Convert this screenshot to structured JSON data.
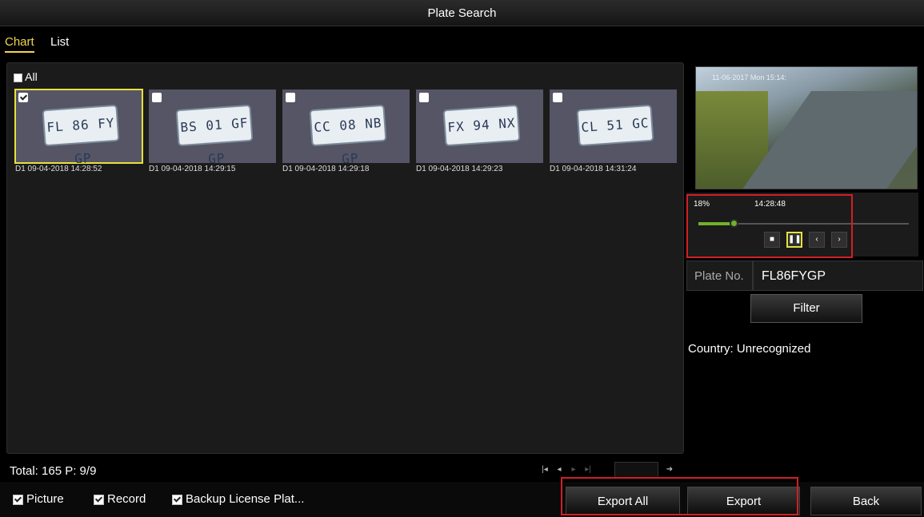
{
  "window": {
    "title": "Plate Search"
  },
  "tabs": [
    {
      "label": "Chart"
    },
    {
      "label": "List"
    }
  ],
  "select_all": {
    "label": "All",
    "checked": false
  },
  "results": [
    {
      "caption": "D1 09-04-2018 14:28:52",
      "plate_text": "FL 86 FY GP",
      "checked": true,
      "selected": true
    },
    {
      "caption": "D1 09-04-2018 14:29:15",
      "plate_text": "BS 01 GF GP",
      "checked": false,
      "selected": false
    },
    {
      "caption": "D1 09-04-2018 14:29:18",
      "plate_text": "CC 08 NB GP",
      "checked": false,
      "selected": false
    },
    {
      "caption": "D1 09-04-2018 14:29:23",
      "plate_text": "FX 94 NX",
      "checked": false,
      "selected": false
    },
    {
      "caption": "D1 09-04-2018 14:31:24",
      "plate_text": "CL 51 GC",
      "checked": false,
      "selected": false
    }
  ],
  "preview": {
    "osd_text": "11-06-2017 Mon 15:14:"
  },
  "playback": {
    "progress_label": "18%",
    "progress_fraction": 0.18,
    "time": "14:28:48",
    "buttons": [
      {
        "name": "stop-button",
        "icon": "stop-icon",
        "glyph": "■"
      },
      {
        "name": "pause-button",
        "icon": "pause-icon",
        "glyph": "❚❚"
      },
      {
        "name": "prev-frame-button",
        "icon": "chevron-left-icon",
        "glyph": "‹"
      },
      {
        "name": "next-frame-button",
        "icon": "chevron-right-icon",
        "glyph": "›"
      }
    ]
  },
  "plate_no": {
    "label": "Plate No.",
    "value": "FL86FYGP"
  },
  "filter_button": {
    "label": "Filter"
  },
  "country": {
    "text": "Country: Unrecognized"
  },
  "summary": {
    "total": "Total: 165  P: 9/9"
  },
  "pager": {
    "first": "|◂",
    "prev": "◂",
    "next": "▸",
    "last": "▸|",
    "go": "➜"
  },
  "options": [
    {
      "label": "Picture",
      "checked": true
    },
    {
      "label": "Record",
      "checked": true
    },
    {
      "label": "Backup License Plat...",
      "checked": true
    }
  ],
  "actions": {
    "export_all": "Export All",
    "export": "Export",
    "back": "Back"
  },
  "colors": {
    "accent": "#f2d64b",
    "highlight": "#d21f25",
    "progress": "#6fb22b"
  }
}
